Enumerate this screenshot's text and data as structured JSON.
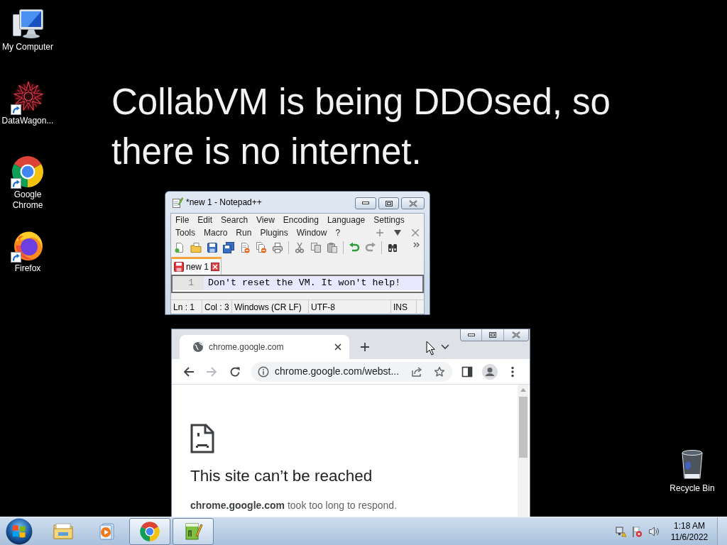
{
  "desktop": {
    "wallpaper_text": "CollabVM is being DDOsed, so there is no internet.",
    "icons": [
      {
        "label": "My Computer",
        "kind": "computer",
        "shortcut": false
      },
      {
        "label": "DataWagon...",
        "kind": "starburst",
        "shortcut": true
      },
      {
        "label": "Google Chrome",
        "kind": "chrome",
        "shortcut": true
      },
      {
        "label": "Firefox",
        "kind": "firefox",
        "shortcut": true
      }
    ],
    "recycle_bin": {
      "label": "Recycle Bin"
    }
  },
  "notepad": {
    "title": "*new 1 - Notepad++",
    "menu_rows": [
      [
        "File",
        "Edit",
        "Search",
        "View",
        "Encoding",
        "Language",
        "Settings"
      ],
      [
        "Tools",
        "Macro",
        "Run",
        "Plugins",
        "Window",
        "?"
      ]
    ],
    "tabs": [
      {
        "label": "new 1",
        "selected": true
      }
    ],
    "lines": [
      {
        "number": "1",
        "text": "Don't reset the VM. It won't help!"
      }
    ],
    "status_bar": [
      "Ln : 1",
      "Col : 3",
      "Windows (CR LF)",
      "UTF-8",
      "INS"
    ]
  },
  "chrome": {
    "tabs": [
      {
        "title": "chrome.google.com",
        "selected": true
      }
    ],
    "address": "chrome.google.com/webst...",
    "forward_disabled": true,
    "error": {
      "heading": "This site can’t be reached",
      "message": "**chrome.google.com** took too long to respond."
    }
  },
  "taskbar": {
    "items": [
      {
        "kind": "explorer",
        "running": false
      },
      {
        "kind": "media_player",
        "running": false
      },
      {
        "kind": "chrome",
        "running": true
      },
      {
        "kind": "notepadpp",
        "running": true
      }
    ],
    "clock": {
      "time": "1:18 AM",
      "date": "11/6/2022"
    }
  }
}
